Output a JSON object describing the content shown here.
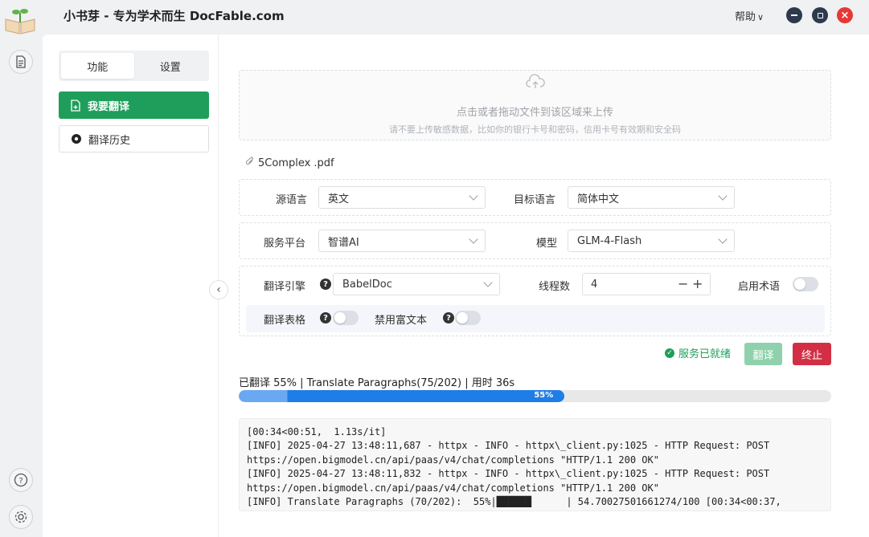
{
  "app": {
    "title": "小书芽 - 专为学术而生 DocFable.com",
    "help_menu": "帮助",
    "window_buttons": [
      "minimize",
      "maximize",
      "close"
    ]
  },
  "rail": {
    "icons": [
      "document-icon",
      "help-circle-icon",
      "settings-gear-icon"
    ]
  },
  "sidebar": {
    "tabs": [
      {
        "label": "功能",
        "active": true
      },
      {
        "label": "设置",
        "active": false
      }
    ],
    "nav": [
      {
        "label": "我要翻译",
        "icon": "file-plus-icon",
        "active": true
      },
      {
        "label": "翻译历史",
        "icon": "history-disc-icon",
        "active": false
      }
    ]
  },
  "upload": {
    "main_text": "点击或者拖动文件到该区域来上传",
    "sub_text": "请不要上传敏感数据，比如你的银行卡号和密码，信用卡号有效期和安全码"
  },
  "file": {
    "name": "5Complex .pdf"
  },
  "options": {
    "source_lang_label": "源语言",
    "source_lang_value": "英文",
    "target_lang_label": "目标语言",
    "target_lang_value": "简体中文",
    "platform_label": "服务平台",
    "platform_value": "智谱AI",
    "model_label": "模型",
    "model_value": "GLM-4-Flash",
    "engine_label": "翻译引擎",
    "engine_value": "BabelDoc",
    "threads_label": "线程数",
    "threads_value": "4",
    "terms_label": "启用术语",
    "terms_enabled": false,
    "table_label": "翻译表格",
    "table_enabled": false,
    "richtext_label": "禁用富文本",
    "richtext_enabled": false
  },
  "actions": {
    "status_text": "服务已就绪",
    "translate_label": "翻译",
    "stop_label": "终止"
  },
  "progress": {
    "status_text": "已翻译 55% | Translate Paragraphs(75/202) | 用时 36s",
    "percent": 55,
    "percent_label": "55%"
  },
  "log": {
    "lines": [
      "[00:34<00:51,  1.13s/it]",
      "[INFO] 2025-04-27 13:48:11,687 - httpx - INFO - httpx\\_client.py:1025 - HTTP Request: POST",
      "https://open.bigmodel.cn/api/paas/v4/chat/completions \"HTTP/1.1 200 OK\"",
      "[INFO] 2025-04-27 13:48:11,832 - httpx - INFO - httpx\\_client.py:1025 - HTTP Request: POST",
      "https://open.bigmodel.cn/api/paas/v4/chat/completions \"HTTP/1.1 200 OK\"",
      "[INFO] Translate Paragraphs (70/202):  55%|██████      | 54.70027501661274/100 [00:34<00:37,"
    ]
  },
  "colors": {
    "primary_green": "#1e9e5a",
    "stop_red": "#d32f44",
    "progress_blue": "#1f7de6",
    "close_red": "#e53935"
  }
}
